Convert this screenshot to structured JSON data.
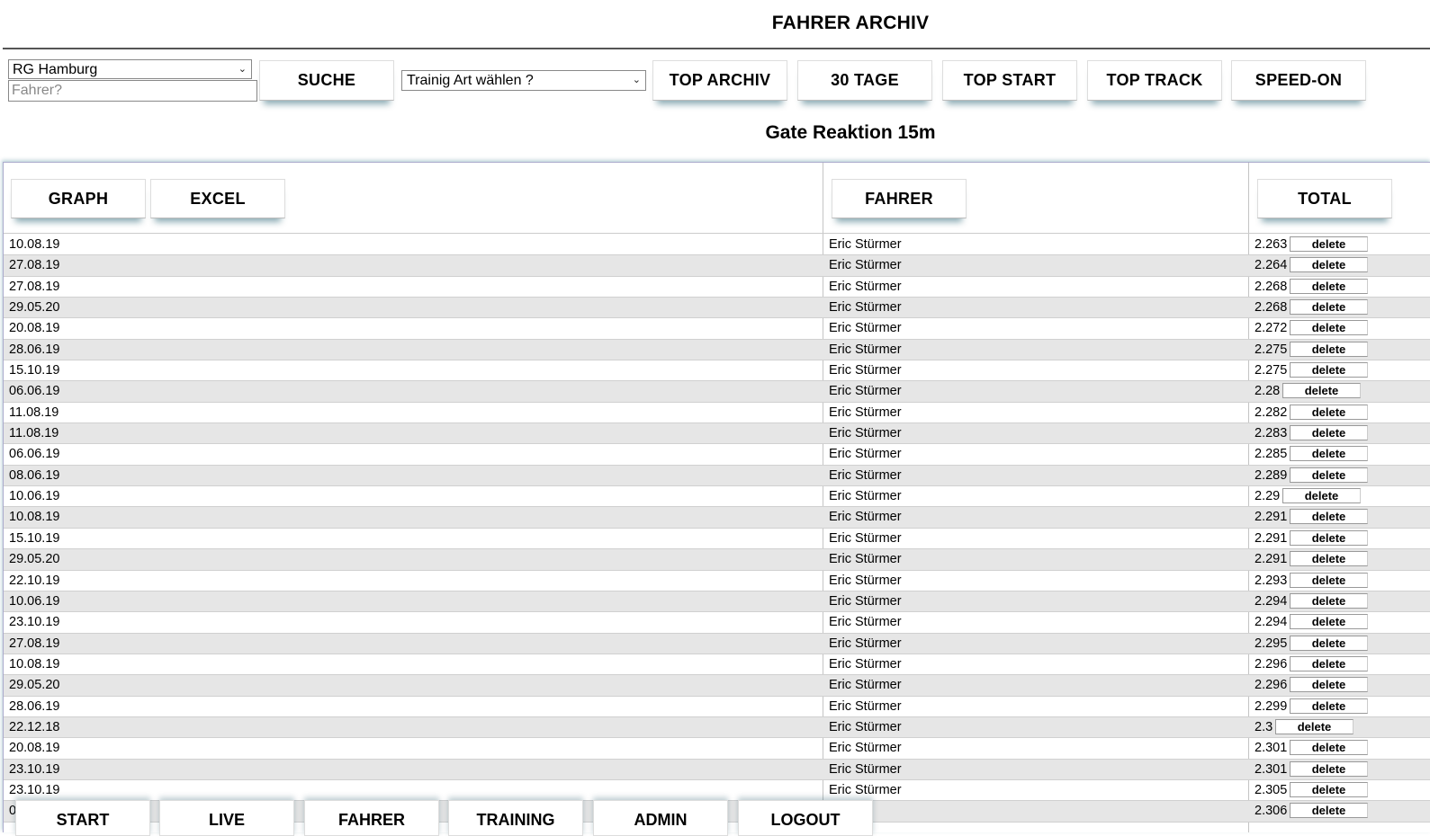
{
  "header": {
    "title": "FAHRER ARCHIV",
    "subtitle": "Gate Reaktion 15m"
  },
  "filters": {
    "team_select_value": "RG Hamburg",
    "fahrer_placeholder": "Fahrer?",
    "search_label": "SUCHE",
    "training_select_value": "Trainig Art wählen ?"
  },
  "top_buttons": [
    "TOP ARCHIV",
    "30 TAGE",
    "TOP START",
    "TOP TRACK",
    "SPEED-ON"
  ],
  "table": {
    "header_buttons": {
      "graph": "GRAPH",
      "excel": "EXCEL",
      "fahrer": "FAHRER",
      "total": "TOTAL"
    },
    "delete_label": "delete",
    "rows": [
      {
        "date": "10.08.19",
        "fahrer": "Eric Stürmer",
        "total": "2.263"
      },
      {
        "date": "27.08.19",
        "fahrer": "Eric Stürmer",
        "total": "2.264"
      },
      {
        "date": "27.08.19",
        "fahrer": "Eric Stürmer",
        "total": "2.268"
      },
      {
        "date": "29.05.20",
        "fahrer": "Eric Stürmer",
        "total": "2.268"
      },
      {
        "date": "20.08.19",
        "fahrer": "Eric Stürmer",
        "total": "2.272"
      },
      {
        "date": "28.06.19",
        "fahrer": "Eric Stürmer",
        "total": "2.275"
      },
      {
        "date": "15.10.19",
        "fahrer": "Eric Stürmer",
        "total": "2.275"
      },
      {
        "date": "06.06.19",
        "fahrer": "Eric Stürmer",
        "total": "2.28"
      },
      {
        "date": "11.08.19",
        "fahrer": "Eric Stürmer",
        "total": "2.282"
      },
      {
        "date": "11.08.19",
        "fahrer": "Eric Stürmer",
        "total": "2.283"
      },
      {
        "date": "06.06.19",
        "fahrer": "Eric Stürmer",
        "total": "2.285"
      },
      {
        "date": "08.06.19",
        "fahrer": "Eric Stürmer",
        "total": "2.289"
      },
      {
        "date": "10.06.19",
        "fahrer": "Eric Stürmer",
        "total": "2.29"
      },
      {
        "date": "10.08.19",
        "fahrer": "Eric Stürmer",
        "total": "2.291"
      },
      {
        "date": "15.10.19",
        "fahrer": "Eric Stürmer",
        "total": "2.291"
      },
      {
        "date": "29.05.20",
        "fahrer": "Eric Stürmer",
        "total": "2.291"
      },
      {
        "date": "22.10.19",
        "fahrer": "Eric Stürmer",
        "total": "2.293"
      },
      {
        "date": "10.06.19",
        "fahrer": "Eric Stürmer",
        "total": "2.294"
      },
      {
        "date": "23.10.19",
        "fahrer": "Eric Stürmer",
        "total": "2.294"
      },
      {
        "date": "27.08.19",
        "fahrer": "Eric Stürmer",
        "total": "2.295"
      },
      {
        "date": "10.08.19",
        "fahrer": "Eric Stürmer",
        "total": "2.296"
      },
      {
        "date": "29.05.20",
        "fahrer": "Eric Stürmer",
        "total": "2.296"
      },
      {
        "date": "28.06.19",
        "fahrer": "Eric Stürmer",
        "total": "2.299"
      },
      {
        "date": "22.12.18",
        "fahrer": "Eric Stürmer",
        "total": "2.3"
      },
      {
        "date": "20.08.19",
        "fahrer": "Eric Stürmer",
        "total": "2.301"
      },
      {
        "date": "23.10.19",
        "fahrer": "Eric Stürmer",
        "total": "2.301"
      },
      {
        "date": "23.10.19",
        "fahrer": "Eric Stürmer",
        "total": "2.305"
      },
      {
        "date": "0",
        "fahrer": "rmer",
        "total": "2.306"
      }
    ]
  },
  "bottom_nav": [
    "START",
    "LIVE",
    "FAHRER",
    "TRAINING",
    "ADMIN",
    "LOGOUT"
  ],
  "icons": {
    "dropdown": "chevron-down-icon"
  }
}
